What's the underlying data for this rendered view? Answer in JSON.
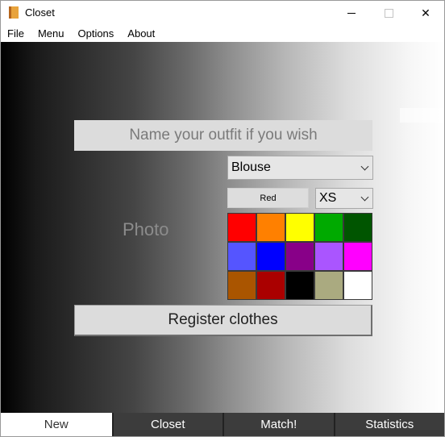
{
  "window": {
    "title": "Closet",
    "icon": "closet-app-icon"
  },
  "menu": {
    "items": [
      "File",
      "Menu",
      "Options",
      "About"
    ]
  },
  "form": {
    "name_placeholder": "Name your outfit if you wish",
    "type_value": "Blouse",
    "color_button_label": "Red",
    "size_value": "XS",
    "photo_label": "Photo",
    "register_label": "Register clothes"
  },
  "palette": {
    "colors": [
      "#ff0000",
      "#ff8000",
      "#ffff00",
      "#00aa00",
      "#005500",
      "#5555ff",
      "#0000ff",
      "#880088",
      "#aa55ff",
      "#ff00ff",
      "#aa5500",
      "#aa0000",
      "#000000",
      "#aaaa80",
      "#ffffff"
    ]
  },
  "tabs": [
    {
      "label": "New",
      "active": true
    },
    {
      "label": "Closet",
      "active": false
    },
    {
      "label": "Match!",
      "active": false
    },
    {
      "label": "Statistics",
      "active": false
    }
  ]
}
